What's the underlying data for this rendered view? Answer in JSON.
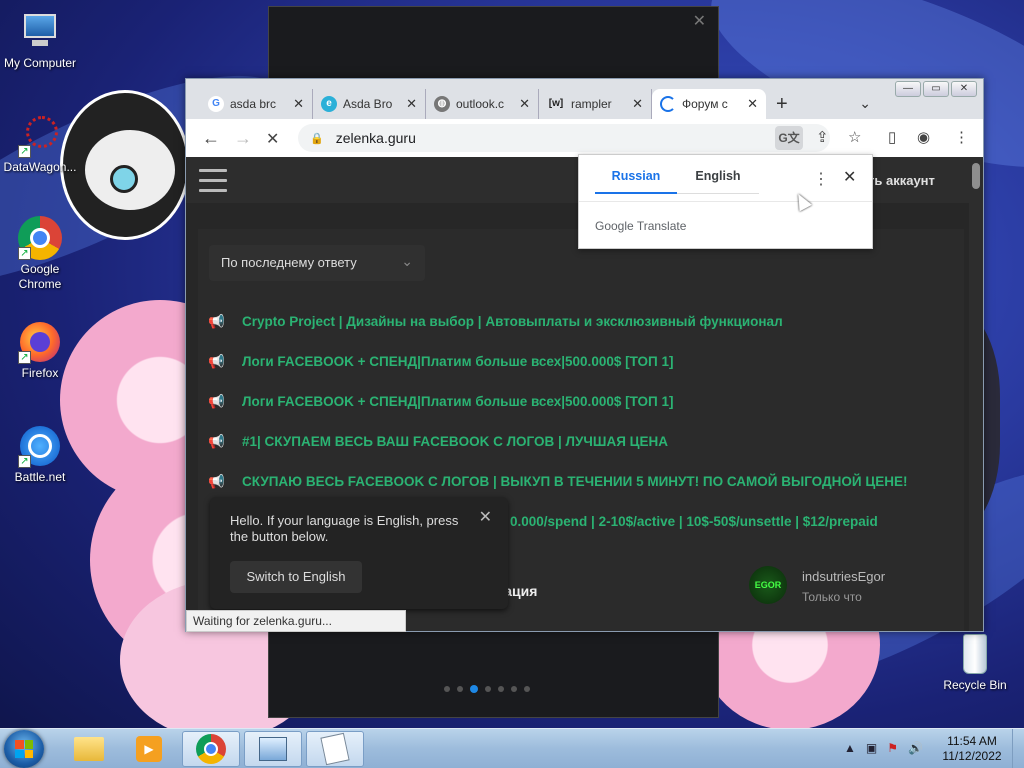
{
  "desktop": {
    "icons": [
      {
        "label": "My Computer"
      },
      {
        "label": "DataWagon..."
      },
      {
        "label": "Google Chrome"
      },
      {
        "label": "Firefox"
      },
      {
        "label": "Battle.net"
      },
      {
        "label": "Recycle Bin"
      }
    ]
  },
  "chrome": {
    "tabs": [
      {
        "title": "asda brc",
        "icon": "google-icon"
      },
      {
        "title": "Asda Bro",
        "icon": "edge-icon"
      },
      {
        "title": "outlook.c",
        "icon": "globe-icon"
      },
      {
        "title": "rampler",
        "icon": "wiki-icon",
        "icon_text": "[w]"
      },
      {
        "title": "Форум с",
        "icon": "loading-icon"
      }
    ],
    "url": "zelenka.guru",
    "status": "Waiting for zelenka.guru..."
  },
  "translate": {
    "from": "Russian",
    "to": "English",
    "brand": "Google Translate"
  },
  "site": {
    "header_action": "ть аккаунт",
    "sort_label": "По последнему ответу",
    "threads": [
      "Crypto Project | Дизайны на выбор | Автовыплаты и эксклюзивный функционал",
      "Логи FACEBOOK + СПЕНД|Платим больше всех|500.000$ [ТОП 1]",
      "Логи FACEBOOK + СПЕНД|Платим больше всех|500.000$ [ТОП 1]",
      "#1| СКУПАЕМ ВЕСЬ ВАШ FACEBOOK С ЛОГОВ | ЛУЧШАЯ ЦЕНА",
      "СКУПАЮ ВЕСЬ FACEBOOK С ЛОГОВ | ВЫКУП В ТЕЧЕНИИ 5 МИНУТ! ПО САМОЙ ВЫГОДНОЙ ЦЕНЕ!",
      "0.000/spend | 2-10$/active | 10$-50$/unsettle | $12/prepaid"
    ],
    "thread_partial": "тизация",
    "user_name": "indsutriesEgor",
    "user_time": "Только что",
    "avatar_text": "EGOR"
  },
  "lang_popup": {
    "message": "Hello. If your language is English, press the button below.",
    "button": "Switch to English"
  },
  "taskbar": {
    "time": "11:54 AM",
    "date": "11/12/2022"
  },
  "colors": {
    "thread_green": "#2bb373",
    "translate_blue": "#1a73e8"
  }
}
